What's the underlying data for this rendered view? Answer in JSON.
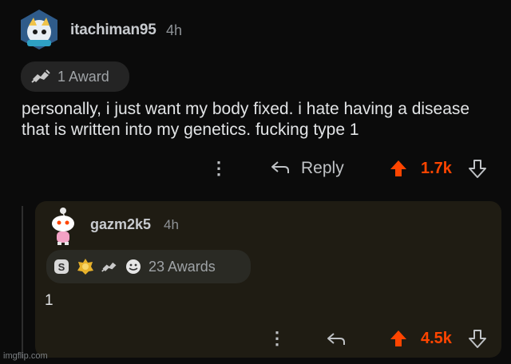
{
  "comment": {
    "username": "itachiman95",
    "time": "4h",
    "award_label": "1 Award",
    "body": "personally, i just want my body fixed. i hate having a disease that is written into my genetics. fucking type 1",
    "reply_label": "Reply",
    "score": "1.7k",
    "icons": [
      "avatar-icon",
      "award-icon",
      "more-icon",
      "reply-icon",
      "upvote-icon",
      "downvote-icon"
    ]
  },
  "reply": {
    "username": "gazm2k5",
    "time": "4h",
    "awards_label": "23 Awards",
    "body": "1",
    "score": "4.5k",
    "icons": [
      "snoo-avatar-icon",
      "silver-award-icon",
      "gold-award-icon",
      "helpful-award-icon",
      "wholesome-award-icon",
      "more-icon",
      "reply-icon",
      "upvote-icon",
      "downvote-icon"
    ]
  },
  "watermark": "imgflip.com",
  "colors": {
    "background": "#0b0b0b",
    "reply_background": "#1f1c13",
    "upvote": "#ff4500",
    "text": "#e2e4e6",
    "muted": "#8e9296"
  }
}
